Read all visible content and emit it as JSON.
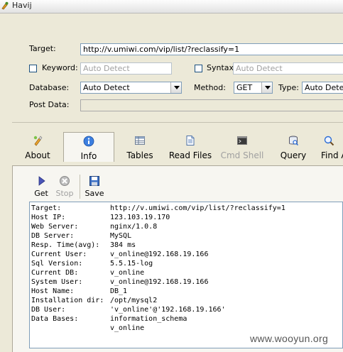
{
  "window": {
    "title": "Havij"
  },
  "form": {
    "target_label": "Target:",
    "target_value": "http://v.umiwi.com/vip/list/?reclassify=1",
    "keyword_label": "Keyword:",
    "keyword_value": "Auto Detect",
    "syntax_label": "Syntax:",
    "syntax_value": "Auto Detect",
    "database_label": "Database:",
    "database_value": "Auto Detect",
    "method_label": "Method:",
    "method_value": "GET",
    "type_label": "Type:",
    "type_value": "Auto Dete",
    "post_data_label": "Post Data:",
    "post_data_value": ""
  },
  "tabs": [
    {
      "label": "About",
      "icon": "about-icon"
    },
    {
      "label": "Info",
      "icon": "info-icon"
    },
    {
      "label": "Tables",
      "icon": "tables-icon"
    },
    {
      "label": "Read Files",
      "icon": "read-files-icon"
    },
    {
      "label": "Cmd Shell",
      "icon": "cmd-shell-icon"
    },
    {
      "label": "Query",
      "icon": "query-icon"
    },
    {
      "label": "Find A",
      "icon": "find-admin-icon"
    }
  ],
  "toolbar": {
    "get_label": "Get",
    "stop_label": "Stop",
    "save_label": "Save"
  },
  "info_rows": [
    {
      "key": "Target:",
      "value": "http://v.umiwi.com/vip/list/?reclassify=1"
    },
    {
      "key": "Host IP:",
      "value": "123.103.19.170"
    },
    {
      "key": "Web Server:",
      "value": "nginx/1.0.8"
    },
    {
      "key": "DB Server:",
      "value": "MySQL"
    },
    {
      "key": "Resp. Time(avg):",
      "value": "384 ms"
    },
    {
      "key": "Current User:",
      "value": "v_online@192.168.19.166"
    },
    {
      "key": "Sql Version:",
      "value": "5.5.15-log"
    },
    {
      "key": "Current DB:",
      "value": "v_online"
    },
    {
      "key": "System User:",
      "value": "v_online@192.168.19.166"
    },
    {
      "key": "Host Name:",
      "value": "DB_1"
    },
    {
      "key": "Installation dir:",
      "value": "/opt/mysql2"
    },
    {
      "key": "DB User:",
      "value": "'v_online'@'192.168.19.166'"
    },
    {
      "key": "Data Bases:",
      "value": "information_schema"
    },
    {
      "key": "",
      "value": "v_online"
    }
  ],
  "watermark": "www.wooyun.org",
  "colors": {
    "accent": "#2b6cd4",
    "window_bg": "#ece9d8",
    "panel_bg": "#f7f6f1"
  }
}
